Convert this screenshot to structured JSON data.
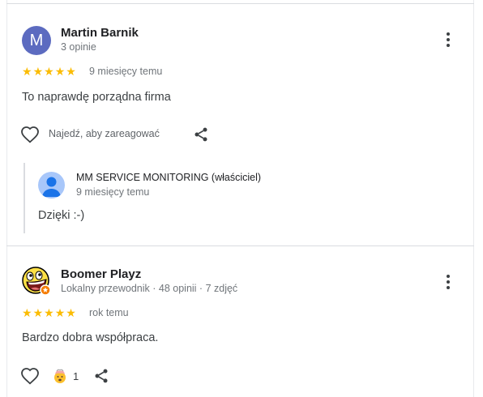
{
  "review1": {
    "avatar_letter": "M",
    "author": "Martin Barnik",
    "meta": "3 opinie",
    "rating": 5,
    "stars": "★★★★★",
    "time": "9 miesięcy temu",
    "text": "To naprawdę porządna firma",
    "react_label": "Najedź, aby zareagować",
    "reply": {
      "owner": "MM SERVICE MONITORING (właściciel)",
      "time": "9 miesięcy temu",
      "text": "Dzięki :-)"
    }
  },
  "review2": {
    "author": "Boomer Playz",
    "meta": "Lokalny przewodnik · 48 opinii · 7 zdjęć",
    "rating": 5,
    "stars": "★★★★★",
    "time": "rok temu",
    "text": "Bardzo dobra współpraca.",
    "reaction_count": "1"
  },
  "colors": {
    "star": "#fbbc04",
    "avatar_m": "#5c6bc0",
    "local_guide_badge": "#f57c00"
  },
  "icons": [
    "heart-outline-icon",
    "share-icon",
    "more-vert-icon",
    "person-icon",
    "mind-blown-emoji-icon",
    "awesome-face-avatar"
  ]
}
